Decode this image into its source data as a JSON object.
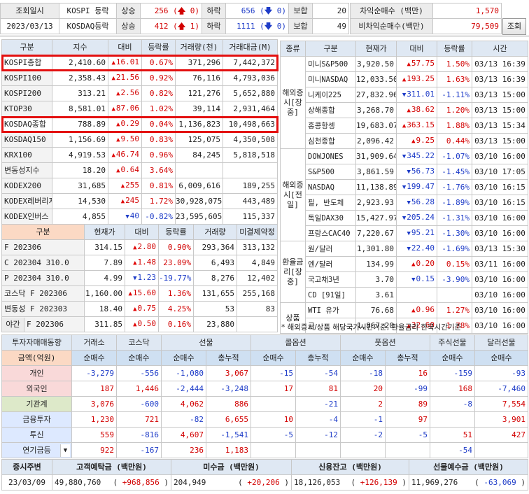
{
  "top": {
    "label": "조회일시",
    "date": "2023/03/13",
    "rows": [
      {
        "market": "KOSPI 등락",
        "up_label": "상승",
        "up": "256",
        "up_chg": "0",
        "down_label": "하락",
        "down": "656",
        "down_chg": "0",
        "flat_label": "보합",
        "flat": "20"
      },
      {
        "market": "KOSDAQ등락",
        "up_label": "상승",
        "up": "412",
        "up_chg": "1",
        "down_label": "하락",
        "down": "1111",
        "down_chg": "0",
        "flat_label": "보합",
        "flat": "49"
      }
    ],
    "arb_label": "차익순매수 (백만)",
    "arb": "1,570",
    "nonarb_label": "비차익순매수(백만)",
    "nonarb": "79,509",
    "query_btn": "조회"
  },
  "index_table": {
    "headers": [
      "구분",
      "지수",
      "대비",
      "등락률",
      "거래량(천)",
      "거래대금(M)"
    ],
    "rows": [
      {
        "name": "KOSPI종합",
        "value": "2,410.60",
        "dir": "up",
        "chg": "16.01",
        "pct": "0.67%",
        "vol": "371,296",
        "amt": "7,442,372",
        "hl": true
      },
      {
        "name": "KOSPI100",
        "value": "2,358.43",
        "dir": "up",
        "chg": "21.56",
        "pct": "0.92%",
        "vol": "76,116",
        "amt": "4,793,036"
      },
      {
        "name": "KOSPI200",
        "value": "313.21",
        "dir": "up",
        "chg": "2.56",
        "pct": "0.82%",
        "vol": "121,276",
        "amt": "5,652,880"
      },
      {
        "name": "KTOP30",
        "value": "8,581.01",
        "dir": "up",
        "chg": "87.06",
        "pct": "1.02%",
        "vol": "39,114",
        "amt": "2,931,464"
      },
      {
        "name": "KOSDAQ종합",
        "value": "788.89",
        "dir": "up",
        "chg": "0.29",
        "pct": "0.04%",
        "vol": "1,136,823",
        "amt": "10,498,663",
        "hl": true
      },
      {
        "name": "KOSDAQ150",
        "value": "1,156.69",
        "dir": "up",
        "chg": "9.50",
        "pct": "0.83%",
        "vol": "125,075",
        "amt": "4,350,508"
      },
      {
        "name": "KRX100",
        "value": "4,919.53",
        "dir": "up",
        "chg": "46.74",
        "pct": "0.96%",
        "vol": "84,245",
        "amt": "5,818,518"
      },
      {
        "name": "변동성지수",
        "value": "18.20",
        "dir": "up",
        "chg": "0.64",
        "pct": "3.64%",
        "vol": "",
        "amt": ""
      },
      {
        "name": "KODEX200",
        "value": "31,685",
        "dir": "up",
        "chg": "255",
        "pct": "0.81%",
        "vol": "6,009,616",
        "amt": "189,255"
      },
      {
        "name": "KODEX레버리지",
        "value": "14,530",
        "dir": "up",
        "chg": "245",
        "pct": "1.72%",
        "vol": "30,928,075",
        "amt": "443,489"
      },
      {
        "name": "KODEX인버스",
        "value": "4,855",
        "dir": "dn",
        "chg": "40",
        "pct": "-0.82%",
        "vol": "23,595,605",
        "amt": "115,337"
      }
    ]
  },
  "futures_table": {
    "headers": [
      "구분",
      "현재가",
      "대비",
      "등락률",
      "거래량",
      "미결제약정"
    ],
    "rows": [
      {
        "name": "F 202306",
        "value": "314.15",
        "dir": "up",
        "chg": "2.80",
        "pct": "0.90%",
        "vol": "293,364",
        "oi": "313,132"
      },
      {
        "name": "C 202304 310.0",
        "value": "7.89",
        "dir": "up",
        "chg": "1.48",
        "pct": "23.09%",
        "vol": "6,493",
        "oi": "4,849"
      },
      {
        "name": "P 202304 310.0",
        "value": "4.99",
        "dir": "dn",
        "chg": "1.23",
        "pct": "-19.77%",
        "vol": "8,276",
        "oi": "12,402"
      },
      {
        "name": "코스닥 F 202306",
        "value": "1,160.00",
        "dir": "up",
        "chg": "15.60",
        "pct": "1.36%",
        "vol": "131,655",
        "oi": "255,168"
      },
      {
        "name": "변동성 F 202303",
        "value": "18.40",
        "dir": "up",
        "chg": "0.75",
        "pct": "4.25%",
        "vol": "53",
        "oi": "83"
      },
      {
        "name_a": "야간",
        "name": "F 202306",
        "value": "311.85",
        "dir": "up",
        "chg": "0.50",
        "pct": "0.16%",
        "vol": "23,880",
        "oi": ""
      }
    ]
  },
  "world_table": {
    "headers": [
      "종류",
      "구분",
      "현재가",
      "대비",
      "등락률",
      "시간"
    ],
    "groups": [
      "해외증시[장중]",
      "해외증시[전일]",
      "환율금리[장중]",
      "상품"
    ],
    "rows": [
      {
        "name": "미니S&P500",
        "value": "3,920.50",
        "dir": "up",
        "chg": "57.75",
        "pct": "1.50%",
        "time": "03/13 16:39"
      },
      {
        "name": "미니NASDAQ",
        "value": "12,033.50",
        "dir": "up",
        "chg": "193.25",
        "pct": "1.63%",
        "time": "03/13 16:39"
      },
      {
        "name": "니케이225",
        "value": "27,832.96",
        "dir": "dn",
        "chg": "311.01",
        "pct": "-1.11%",
        "time": "03/13 15:00"
      },
      {
        "name": "상해종합",
        "value": "3,268.70",
        "dir": "up",
        "chg": "38.62",
        "pct": "1.20%",
        "time": "03/13 15:00"
      },
      {
        "name": "홍콩항셍",
        "value": "19,683.07",
        "dir": "up",
        "chg": "363.15",
        "pct": "1.88%",
        "time": "03/13 15:34"
      },
      {
        "name": "심천종합",
        "value": "2,096.42",
        "dir": "up",
        "chg": "9.25",
        "pct": "0.44%",
        "time": "03/13 15:00"
      },
      {
        "name": "DOWJONES",
        "value": "31,909.64",
        "dir": "dn",
        "chg": "345.22",
        "pct": "-1.07%",
        "time": "03/10 16:00"
      },
      {
        "name": "S&P500",
        "value": "3,861.59",
        "dir": "dn",
        "chg": "56.73",
        "pct": "-1.45%",
        "time": "03/10 17:05"
      },
      {
        "name": "NASDAQ",
        "value": "11,138.89",
        "dir": "dn",
        "chg": "199.47",
        "pct": "-1.76%",
        "time": "03/10 16:15"
      },
      {
        "name": "필, 반도체",
        "value": "2,923.93",
        "dir": "dn",
        "chg": "56.28",
        "pct": "-1.89%",
        "time": "03/10 16:15"
      },
      {
        "name": "독일DAX30",
        "value": "15,427.97",
        "dir": "dn",
        "chg": "205.24",
        "pct": "-1.31%",
        "time": "03/10 16:00"
      },
      {
        "name": "프랑스CAC40",
        "value": "7,220.67",
        "dir": "dn",
        "chg": "95.21",
        "pct": "-1.30%",
        "time": "03/10 16:00"
      },
      {
        "name": "원/달러",
        "value": "1,301.80",
        "dir": "dn",
        "chg": "22.40",
        "pct": "-1.69%",
        "time": "03/13 15:30"
      },
      {
        "name": "엔/달러",
        "value": "134.99",
        "dir": "up",
        "chg": "0.20",
        "pct": "0.15%",
        "time": "03/11 16:00"
      },
      {
        "name": "국고채3년",
        "value": "3.70",
        "dir": "dn",
        "chg": "0.15",
        "pct": "-3.90%",
        "time": "03/10 16:00"
      },
      {
        "name": "CD [91일]",
        "value": "3.61",
        "dir": "",
        "chg": "",
        "pct": "",
        "time": "03/10 16:00"
      },
      {
        "name": "WTI 유가",
        "value": "76.68",
        "dir": "up",
        "chg": "0.96",
        "pct": "1.27%",
        "time": "03/10 16:00"
      },
      {
        "name": "금",
        "value": "1,867.20",
        "dir": "up",
        "chg": "32.60",
        "pct": "1.78%",
        "time": "03/10 16:00"
      }
    ],
    "footnote": "* 해외증시/상품 해당국가시간기준, 환율금리 한국시간기준"
  },
  "investor_table": {
    "head1": [
      "투자자매매동향",
      "거래소",
      "코스닥",
      "선물",
      "콜옵션",
      "풋옵션",
      "주식선물",
      "달러선물"
    ],
    "unit": "금액(억원)",
    "head2": [
      "순매수",
      "순매수",
      "순매수",
      "총누적",
      "순매수",
      "총누적",
      "순매수",
      "총누적",
      "순매수",
      "순매수"
    ],
    "rows": [
      {
        "name": "개인",
        "v": [
          "-3,279",
          "-556",
          "-1,080",
          "3,067",
          "-15",
          "-54",
          "-18",
          "16",
          "-159",
          "-93"
        ]
      },
      {
        "name": "외국인",
        "v": [
          "187",
          "1,446",
          "-2,444",
          "-3,248",
          "17",
          "81",
          "20",
          "-99",
          "168",
          "-7,460"
        ]
      },
      {
        "name": "기관계",
        "v": [
          "3,076",
          "-600",
          "4,062",
          "886",
          "",
          "-21",
          "2",
          "89",
          "-8",
          "7,554"
        ]
      },
      {
        "name": "금융투자",
        "v": [
          "1,230",
          "721",
          "-82",
          "6,655",
          "10",
          "-4",
          "-1",
          "97",
          "",
          "3,901"
        ]
      },
      {
        "name": "투신",
        "v": [
          "559",
          "-816",
          "4,607",
          "-1,541",
          "-5",
          "-12",
          "-2",
          "-5",
          "51",
          "427"
        ]
      },
      {
        "name": "연기금등",
        "v": [
          "922",
          "-167",
          "236",
          "1,183",
          "",
          "",
          "",
          "",
          "-54",
          ""
        ]
      }
    ]
  },
  "bottom": {
    "headers": [
      "증시주변",
      "고객예탁금 (백만원)",
      "미수금 (백만원)",
      "신용잔고 (백만원)",
      "선물예수금 (백만원)"
    ],
    "date": "23/03/09",
    "vals": [
      {
        "v": "49,880,760",
        "d": "+968,856"
      },
      {
        "v": "204,949",
        "d": "+20,206"
      },
      {
        "v": "18,126,053",
        "d": "+126,139"
      },
      {
        "v": "11,969,276",
        "d": "-63,069"
      }
    ]
  },
  "colors": {
    "up": "#d20000",
    "down": "#1e3cc8",
    "header": "#dfe8f3",
    "highlight": "#e31010"
  }
}
